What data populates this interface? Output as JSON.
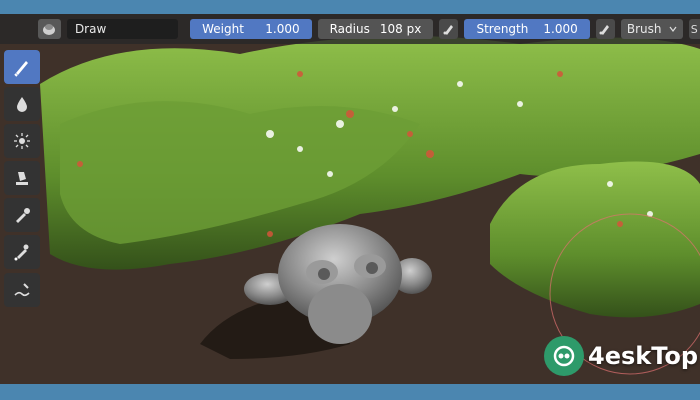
{
  "toolbar": {
    "mode_icon": "sculpt-mode-icon",
    "tool_name": "Draw",
    "weight": {
      "label": "Weight",
      "value": "1.000"
    },
    "radius": {
      "label": "Radius",
      "value": "108 px"
    },
    "strength": {
      "label": "Strength",
      "value": "1.000"
    },
    "brush_menu": "Brush",
    "overflow": "S"
  },
  "tools": [
    {
      "name": "draw",
      "icon": "brush-icon",
      "active": true
    },
    {
      "name": "blur",
      "icon": "drop-icon",
      "active": false
    },
    {
      "name": "smear",
      "icon": "sparkle-icon",
      "active": false
    },
    {
      "name": "clone",
      "icon": "stamp-icon",
      "active": false
    },
    {
      "name": "sample",
      "icon": "eyedropper-icon",
      "active": false
    },
    {
      "name": "fill",
      "icon": "fill-icon",
      "active": false
    },
    {
      "name": "annotate",
      "icon": "annotate-icon",
      "active": false
    }
  ],
  "watermark": {
    "text": "4eskTop"
  },
  "colors": {
    "accent": "#5178c2",
    "frame": "#4b86b0",
    "toolbar": "#2b2b2b"
  }
}
